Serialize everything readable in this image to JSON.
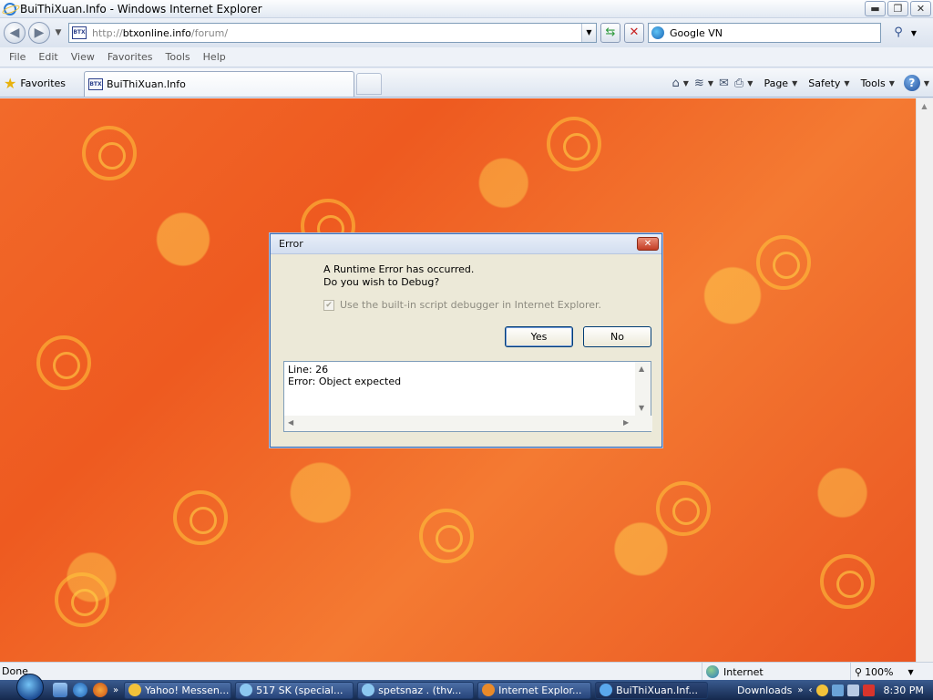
{
  "window": {
    "title": "BuiThiXuan.Info - Windows Internet Explorer",
    "minimize_glyph": "▬",
    "maximize_glyph": "❐",
    "close_glyph": "✕"
  },
  "address": {
    "url_prefix": "http://",
    "url_host": "btxonline.info",
    "url_path": "/forum/",
    "favicon_text": "BTX"
  },
  "search": {
    "provider": "Google VN"
  },
  "menu": [
    "File",
    "Edit",
    "View",
    "Favorites",
    "Tools",
    "Help"
  ],
  "favorites": {
    "label": "Favorites"
  },
  "tab": {
    "label": "BuiThiXuan.Info",
    "favicon_text": "BTX"
  },
  "command_bar": {
    "page_label": "Page",
    "safety_label": "Safety",
    "tools_label": "Tools"
  },
  "dialog": {
    "title": "Error",
    "message_line1": "A Runtime Error has occurred.",
    "message_line2": "Do you wish to Debug?",
    "checkbox_label": "Use the built-in script debugger in Internet Explorer.",
    "checkbox_checked": true,
    "yes_label": "Yes",
    "no_label": "No",
    "details_line1": "Line: 26",
    "details_line2": "Error: Object expected"
  },
  "status": {
    "text": "Done",
    "zone": "Internet",
    "zoom": "100%"
  },
  "taskbar": {
    "tasks": [
      {
        "label": "Yahoo! Messen...",
        "icon_color": "#f2c23a",
        "active": false
      },
      {
        "label": "517 SK (special...",
        "icon_color": "#8cc8f0",
        "active": false
      },
      {
        "label": "spetsnaz . (thv...",
        "icon_color": "#8cc8f0",
        "active": false
      },
      {
        "label": "Internet Explor...",
        "icon_color": "#e98a2a",
        "active": false
      },
      {
        "label": "BuiThiXuan.Inf...",
        "icon_color": "#5aa8ec",
        "active": true
      }
    ],
    "downloads_label": "Downloads",
    "clock": "8:30 PM"
  },
  "colors": {
    "background_accent": "#f26a2a",
    "dialog_border": "#3d6fb7",
    "close_button": "#c33d24"
  }
}
